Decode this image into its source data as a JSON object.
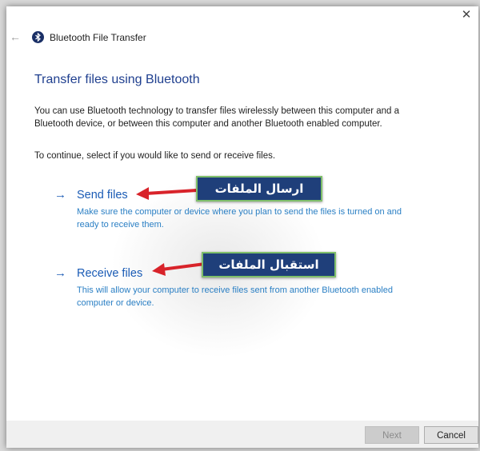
{
  "window": {
    "title": "Bluetooth File Transfer",
    "close_glyph": "✕",
    "back_glyph": "←"
  },
  "main": {
    "heading": "Transfer files using Bluetooth",
    "description": "You can use Bluetooth technology to transfer files wirelessly between this computer and a Bluetooth device, or between this computer and another Bluetooth enabled computer.",
    "instruction": "To continue, select if you would like to send or receive files.",
    "options": [
      {
        "arrow": "→",
        "title": "Send files",
        "description": "Make sure the computer or device where you plan to send the files is turned on and ready to receive them."
      },
      {
        "arrow": "→",
        "title": "Receive files",
        "description": "This will allow your computer to receive files sent from another Bluetooth enabled computer or device."
      }
    ]
  },
  "annotations": [
    {
      "text": "ارسال الملفات"
    },
    {
      "text": "استقبال الملفات"
    }
  ],
  "footer": {
    "next_label": "Next",
    "cancel_label": "Cancel"
  },
  "colors": {
    "link_blue": "#1a5bb5",
    "heading_blue": "#1f3f8f",
    "callout_bg": "#1f3f7a",
    "callout_border": "#7fbf6a",
    "arrow_red": "#d8232a"
  },
  "icons": {
    "title_icon": "bluetooth-icon",
    "back": "back-arrow-icon",
    "close": "close-icon"
  }
}
